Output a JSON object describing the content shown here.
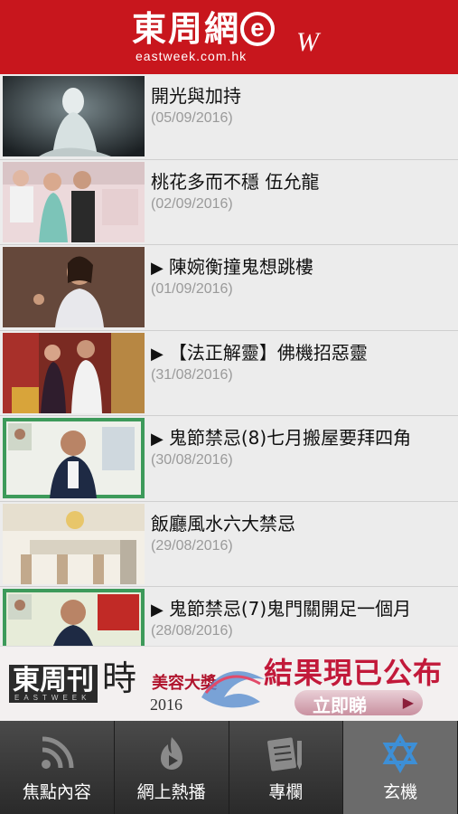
{
  "header": {
    "logo_zh": "東周網",
    "logo_e": "e",
    "logo_w": "W",
    "logo_sub": "eastweek.com.hk"
  },
  "articles": [
    {
      "title": "開光與加持",
      "date": "(05/09/2016)",
      "video": false
    },
    {
      "title": "桃花多而不穩 伍允龍",
      "date": "(02/09/2016)",
      "video": false
    },
    {
      "title": "陳婉衡撞鬼想跳樓",
      "date": "(01/09/2016)",
      "video": true
    },
    {
      "title": "【法正解靈】佛機招惡靈",
      "date": "(31/08/2016)",
      "video": true
    },
    {
      "title": "鬼節禁忌(8)七月搬屋要拜四角",
      "date": "(30/08/2016)",
      "video": true
    },
    {
      "title": "飯廳風水六大禁忌",
      "date": "(29/08/2016)",
      "video": false
    },
    {
      "title": "鬼節禁忌(7)鬼門關開足一個月",
      "date": "(28/08/2016)",
      "video": true
    }
  ],
  "banner": {
    "brand": "東周刊",
    "brand_en": "EASTWEEK",
    "shi": "時",
    "award": "美容大獎",
    "year": "2016",
    "headline": "結果現已公布",
    "cta": "立即睇"
  },
  "tabs": [
    {
      "label": "焦點內容",
      "icon": "rss-icon",
      "active": false
    },
    {
      "label": "網上熱播",
      "icon": "play-flame-icon",
      "active": false
    },
    {
      "label": "專欄",
      "icon": "document-pen-icon",
      "active": false
    },
    {
      "label": "玄機",
      "icon": "star-of-david-icon",
      "active": true
    }
  ],
  "colors": {
    "brand_red": "#c8161d",
    "tab_active": "#6b6b6b",
    "date_gray": "#9a9a9a",
    "banner_red": "#c2193a"
  }
}
